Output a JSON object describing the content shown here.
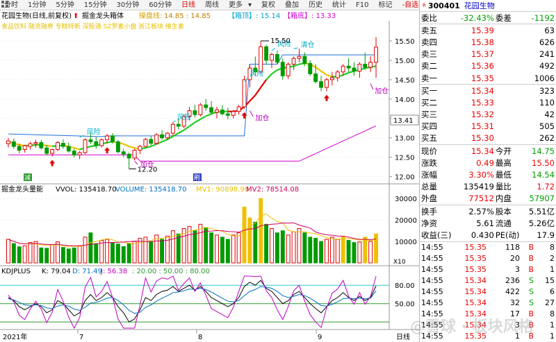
{
  "toolbar": {
    "items": [
      "分时",
      "1分钟",
      "5分钟",
      "15分钟",
      "30分钟",
      "60分钟",
      "日线",
      "周线",
      "更多"
    ],
    "active": "日线",
    "tools": [
      "复权",
      "叠加",
      "历史",
      "统计",
      "F10",
      "标记",
      "-自选"
    ]
  },
  "main_chart": {
    "title": "花园生物(日线,前复权)",
    "indicator": "掘金龙头箱体",
    "label_opline": "操盘线:",
    "opline_values": "14.85 : 14.85",
    "box_top_label": "【箱顶】",
    "box_top_value": ": 15.14",
    "box_bottom_label": "【箱底】",
    "box_bottom_value": ": 13.33",
    "concepts": "食品饮料 融资融券 专精特新 深股通 SZ罗素小盘 浙江板块 维生素",
    "current_price_tag": "13.41",
    "annotations": {
      "high": "15.50",
      "low": "12.20",
      "labels": [
        "风险",
        "风险",
        "风险",
        "风险",
        "清仓",
        "加仓",
        "加仓",
        "加仓"
      ]
    },
    "markers": {
      "s1": "减",
      "s2": "刷"
    }
  },
  "volume_panel": {
    "title": "掘金龙头量能",
    "vvol": "VVOL: 135418.70",
    "volume": "VOLUME: 135418.70",
    "mv1": "MV1: 90898.98",
    "mv2": "MV2: 78514.08",
    "unit": "X10"
  },
  "kdj_panel": {
    "title": "KDJPLUS",
    "k": "K: 79.04",
    "d": "D: 71.49",
    "j": "J: 56.38",
    "lines": ": 20.00 : 50.00 : 80.00"
  },
  "x_axis": {
    "year": "2021年",
    "m7": "7",
    "m8": "8",
    "m9": "9"
  },
  "chart_data": [
    {
      "type": "candlestick",
      "title": "花园生物(日线,前复权)",
      "y_ticks": [
        12.0,
        12.5,
        13.0,
        13.5,
        14.0,
        14.5,
        15.0,
        15.5
      ],
      "ylim": [
        11.85,
        15.75
      ],
      "ohlc": [
        [
          12.85,
          13.0,
          12.75,
          12.92
        ],
        [
          12.9,
          12.98,
          12.72,
          12.78
        ],
        [
          12.78,
          12.85,
          12.6,
          12.68
        ],
        [
          12.7,
          12.82,
          12.62,
          12.8
        ],
        [
          12.78,
          12.9,
          12.7,
          12.85
        ],
        [
          12.85,
          12.95,
          12.75,
          12.88
        ],
        [
          12.88,
          12.95,
          12.7,
          12.74
        ],
        [
          12.74,
          12.82,
          12.55,
          12.6
        ],
        [
          12.6,
          12.72,
          12.52,
          12.7
        ],
        [
          12.7,
          12.92,
          12.66,
          12.88
        ],
        [
          12.86,
          12.96,
          12.72,
          12.78
        ],
        [
          12.78,
          12.88,
          12.62,
          12.66
        ],
        [
          12.66,
          12.72,
          12.5,
          12.56
        ],
        [
          12.56,
          12.66,
          12.45,
          12.62
        ],
        [
          12.62,
          12.98,
          12.58,
          12.95
        ],
        [
          12.95,
          13.12,
          12.84,
          12.9
        ],
        [
          12.9,
          13.02,
          12.72,
          12.8
        ],
        [
          12.8,
          12.98,
          12.75,
          12.95
        ],
        [
          12.95,
          13.1,
          12.85,
          13.05
        ],
        [
          13.05,
          13.12,
          12.85,
          12.9
        ],
        [
          12.9,
          12.95,
          12.6,
          12.64
        ],
        [
          12.64,
          12.72,
          12.5,
          12.58
        ],
        [
          12.58,
          12.62,
          12.2,
          12.48
        ],
        [
          12.48,
          12.72,
          12.42,
          12.68
        ],
        [
          12.68,
          12.82,
          12.58,
          12.78
        ],
        [
          12.78,
          13.0,
          12.74,
          12.96
        ],
        [
          12.96,
          13.05,
          12.8,
          12.86
        ],
        [
          12.86,
          13.12,
          12.82,
          13.08
        ],
        [
          13.08,
          13.2,
          12.95,
          13.0
        ],
        [
          13.0,
          13.15,
          12.95,
          13.12
        ],
        [
          13.12,
          13.4,
          13.05,
          13.35
        ],
        [
          13.35,
          13.5,
          13.22,
          13.3
        ],
        [
          13.3,
          13.6,
          13.25,
          13.55
        ],
        [
          13.55,
          13.8,
          13.45,
          13.7
        ],
        [
          13.7,
          13.85,
          13.52,
          13.6
        ],
        [
          13.6,
          13.9,
          13.55,
          13.85
        ],
        [
          13.85,
          14.0,
          13.7,
          13.78
        ],
        [
          13.78,
          13.95,
          13.6,
          13.66
        ],
        [
          13.66,
          13.8,
          13.5,
          13.72
        ],
        [
          13.72,
          13.85,
          13.58,
          13.62
        ],
        [
          13.62,
          13.78,
          13.48,
          13.58
        ],
        [
          13.58,
          13.72,
          13.5,
          13.68
        ],
        [
          13.68,
          13.85,
          13.6,
          13.8
        ],
        [
          13.8,
          14.6,
          13.75,
          14.5
        ],
        [
          14.5,
          14.9,
          14.3,
          14.8
        ],
        [
          14.8,
          15.1,
          14.6,
          14.7
        ],
        [
          14.7,
          15.5,
          14.65,
          15.35
        ],
        [
          15.35,
          15.4,
          14.9,
          15.0
        ],
        [
          15.0,
          15.2,
          14.8,
          15.15
        ],
        [
          15.15,
          15.25,
          14.9,
          14.95
        ],
        [
          14.95,
          15.05,
          14.5,
          14.6
        ],
        [
          14.6,
          14.95,
          14.52,
          14.9
        ],
        [
          14.9,
          15.1,
          14.75,
          15.05
        ],
        [
          15.05,
          15.3,
          14.95,
          15.1
        ],
        [
          15.1,
          15.2,
          14.85,
          14.92
        ],
        [
          14.92,
          15.0,
          14.6,
          14.65
        ],
        [
          14.65,
          14.9,
          14.4,
          14.45
        ],
        [
          14.45,
          14.6,
          14.2,
          14.3
        ],
        [
          14.3,
          14.55,
          14.2,
          14.5
        ],
        [
          14.5,
          14.7,
          14.35,
          14.55
        ],
        [
          14.55,
          14.75,
          14.45,
          14.7
        ],
        [
          14.7,
          14.9,
          14.6,
          14.85
        ],
        [
          14.85,
          15.05,
          14.7,
          14.8
        ],
        [
          14.8,
          14.95,
          14.6,
          14.72
        ],
        [
          14.72,
          14.95,
          14.55,
          14.9
        ],
        [
          14.9,
          15.2,
          14.75,
          14.82
        ],
        [
          14.82,
          15.1,
          14.7,
          14.95
        ],
        [
          14.95,
          15.6,
          14.55,
          15.34
        ]
      ],
      "volumes": [
        11000,
        9000,
        7500,
        8000,
        9500,
        10000,
        7000,
        6800,
        8500,
        9800,
        7200,
        6500,
        7000,
        8000,
        12000,
        14000,
        9000,
        10500,
        11000,
        9500,
        8800,
        7600,
        9000,
        10000,
        11500,
        12000,
        10000,
        13000,
        11000,
        12500,
        15000,
        13500,
        16000,
        17000,
        15000,
        18000,
        16500,
        14000,
        13000,
        12000,
        11000,
        13000,
        14000,
        26000,
        21000,
        19000,
        30000,
        18000,
        16000,
        14000,
        15000,
        13000,
        14500,
        16000,
        14000,
        12000,
        11500,
        10000,
        11000,
        12000,
        11000,
        12500,
        10500,
        9500,
        9800,
        12000,
        10000,
        13540
      ],
      "ma_values": [
        12.9,
        12.86,
        12.82,
        12.8,
        12.8,
        12.82,
        12.82,
        12.8,
        12.78,
        12.8,
        12.8,
        12.78,
        12.74,
        12.7,
        12.74,
        12.78,
        12.8,
        12.84,
        12.88,
        12.9,
        12.88,
        12.84,
        12.78,
        12.74,
        12.72,
        12.74,
        12.78,
        12.84,
        12.9,
        12.96,
        13.04,
        13.12,
        13.2,
        13.3,
        13.4,
        13.48,
        13.56,
        13.62,
        13.66,
        13.68,
        13.68,
        13.68,
        13.7,
        13.8,
        13.95,
        14.1,
        14.3,
        14.5,
        14.65,
        14.75,
        14.8,
        14.82,
        14.85,
        14.9,
        14.92,
        14.9,
        14.82,
        14.72,
        14.62,
        14.58,
        14.58,
        14.62,
        14.68,
        14.72,
        14.75,
        14.8,
        14.82,
        14.85
      ],
      "k_values": [
        60,
        55,
        45,
        40,
        45,
        50,
        45,
        35,
        40,
        55,
        50,
        40,
        30,
        35,
        55,
        65,
        55,
        60,
        68,
        60,
        45,
        35,
        20,
        25,
        40,
        60,
        55,
        65,
        70,
        72,
        78,
        70,
        75,
        80,
        72,
        78,
        70,
        60,
        55,
        50,
        45,
        50,
        60,
        78,
        85,
        80,
        88,
        75,
        70,
        60,
        50,
        55,
        65,
        70,
        60,
        50,
        42,
        35,
        45,
        55,
        60,
        68,
        60,
        55,
        62,
        55,
        60,
        79
      ],
      "d_values": [
        58,
        56,
        52,
        48,
        47,
        48,
        47,
        43,
        42,
        46,
        48,
        46,
        41,
        39,
        44,
        51,
        52,
        55,
        59,
        60,
        55,
        48,
        39,
        34,
        36,
        44,
        48,
        54,
        59,
        63,
        68,
        69,
        71,
        74,
        73,
        75,
        73,
        69,
        64,
        59,
        54,
        53,
        55,
        63,
        70,
        73,
        78,
        77,
        75,
        70,
        63,
        60,
        62,
        65,
        63,
        59,
        53,
        47,
        46,
        49,
        53,
        58,
        59,
        58,
        59,
        58,
        59,
        71
      ]
    }
  ],
  "quote": {
    "code": "300401",
    "name": "花园生物",
    "r_mark": "R",
    "weibi_label": "委比",
    "weibi": "-32.43%",
    "weicha_label": "委差",
    "weicha": "-1192",
    "asks": [
      {
        "label": "卖五",
        "price": "15.39",
        "vol": "63"
      },
      {
        "label": "卖四",
        "price": "15.38",
        "vol": "626"
      },
      {
        "label": "卖三",
        "price": "15.37",
        "vol": "241"
      },
      {
        "label": "卖二",
        "price": "15.36",
        "vol": "492"
      },
      {
        "label": "卖一",
        "price": "15.35",
        "vol": "1006"
      }
    ],
    "bids": [
      {
        "label": "买一",
        "price": "15.34",
        "vol": "323"
      },
      {
        "label": "买二",
        "price": "15.33",
        "vol": "110"
      },
      {
        "label": "买三",
        "price": "15.32",
        "vol": "42"
      },
      {
        "label": "买四",
        "price": "15.31",
        "vol": "505"
      },
      {
        "label": "买五",
        "price": "15.30",
        "vol": "262"
      }
    ],
    "stats": [
      {
        "l1": "现价",
        "v1": "15.34",
        "l2": "今开",
        "v2": "14.75",
        "c1": "red",
        "c2": "green"
      },
      {
        "l1": "涨跌",
        "v1": "0.49",
        "l2": "最高",
        "v2": "15.50",
        "c1": "red",
        "c2": "red"
      },
      {
        "l1": "涨幅",
        "v1": "3.30%",
        "l2": "最低",
        "v2": "14.54",
        "c1": "red",
        "c2": "green"
      },
      {
        "l1": "总量",
        "v1": "135419",
        "l2": "量比",
        "v2": "1.72",
        "c1": "",
        "c2": "red"
      },
      {
        "l1": "外盘",
        "v1": "77512",
        "l2": "内盘",
        "v2": "57907",
        "c1": "red",
        "c2": "green"
      }
    ],
    "stats2": [
      {
        "l1": "换手",
        "v1": "2.57%",
        "l2": "股本",
        "v2": "5.51亿"
      },
      {
        "l1": "净资",
        "v1": "5.61",
        "l2": "流通",
        "v2": "5.26亿"
      },
      {
        "l1": "收益(三)",
        "v1": "0.430",
        "l2": "PE(动)",
        "v2": "17.9"
      }
    ],
    "ticks": [
      {
        "t": "14:55",
        "p": "15.35",
        "v": "118",
        "s": "B",
        "n": "8"
      },
      {
        "t": "14:55",
        "p": "15.35",
        "v": "20",
        "s": "B",
        "n": "2"
      },
      {
        "t": "14:55",
        "p": "15.35",
        "v": "3",
        "s": "B",
        "n": "1"
      },
      {
        "t": "14:55",
        "p": "15.34",
        "v": "236",
        "s": "S",
        "n": "15"
      },
      {
        "t": "14:55",
        "p": "15.34",
        "v": "422",
        "s": "S",
        "n": "6"
      },
      {
        "t": "14:55",
        "p": "15.34",
        "v": "32",
        "s": "S",
        "n": "27"
      },
      {
        "t": "14:55",
        "p": "15.34",
        "v": "17",
        "s": "B",
        "n": "8"
      },
      {
        "t": "14:55",
        "p": "15.34",
        "v": "3",
        "s": "B",
        "n": "1"
      },
      {
        "t": "14:55",
        "p": "15.35",
        "v": "1",
        "s": "B",
        "n": "1"
      },
      {
        "t": "14:55",
        "p": "15.35",
        "v": "",
        "s": "",
        "n": ""
      }
    ]
  },
  "watermark": "@雪球 · 板块风格"
}
